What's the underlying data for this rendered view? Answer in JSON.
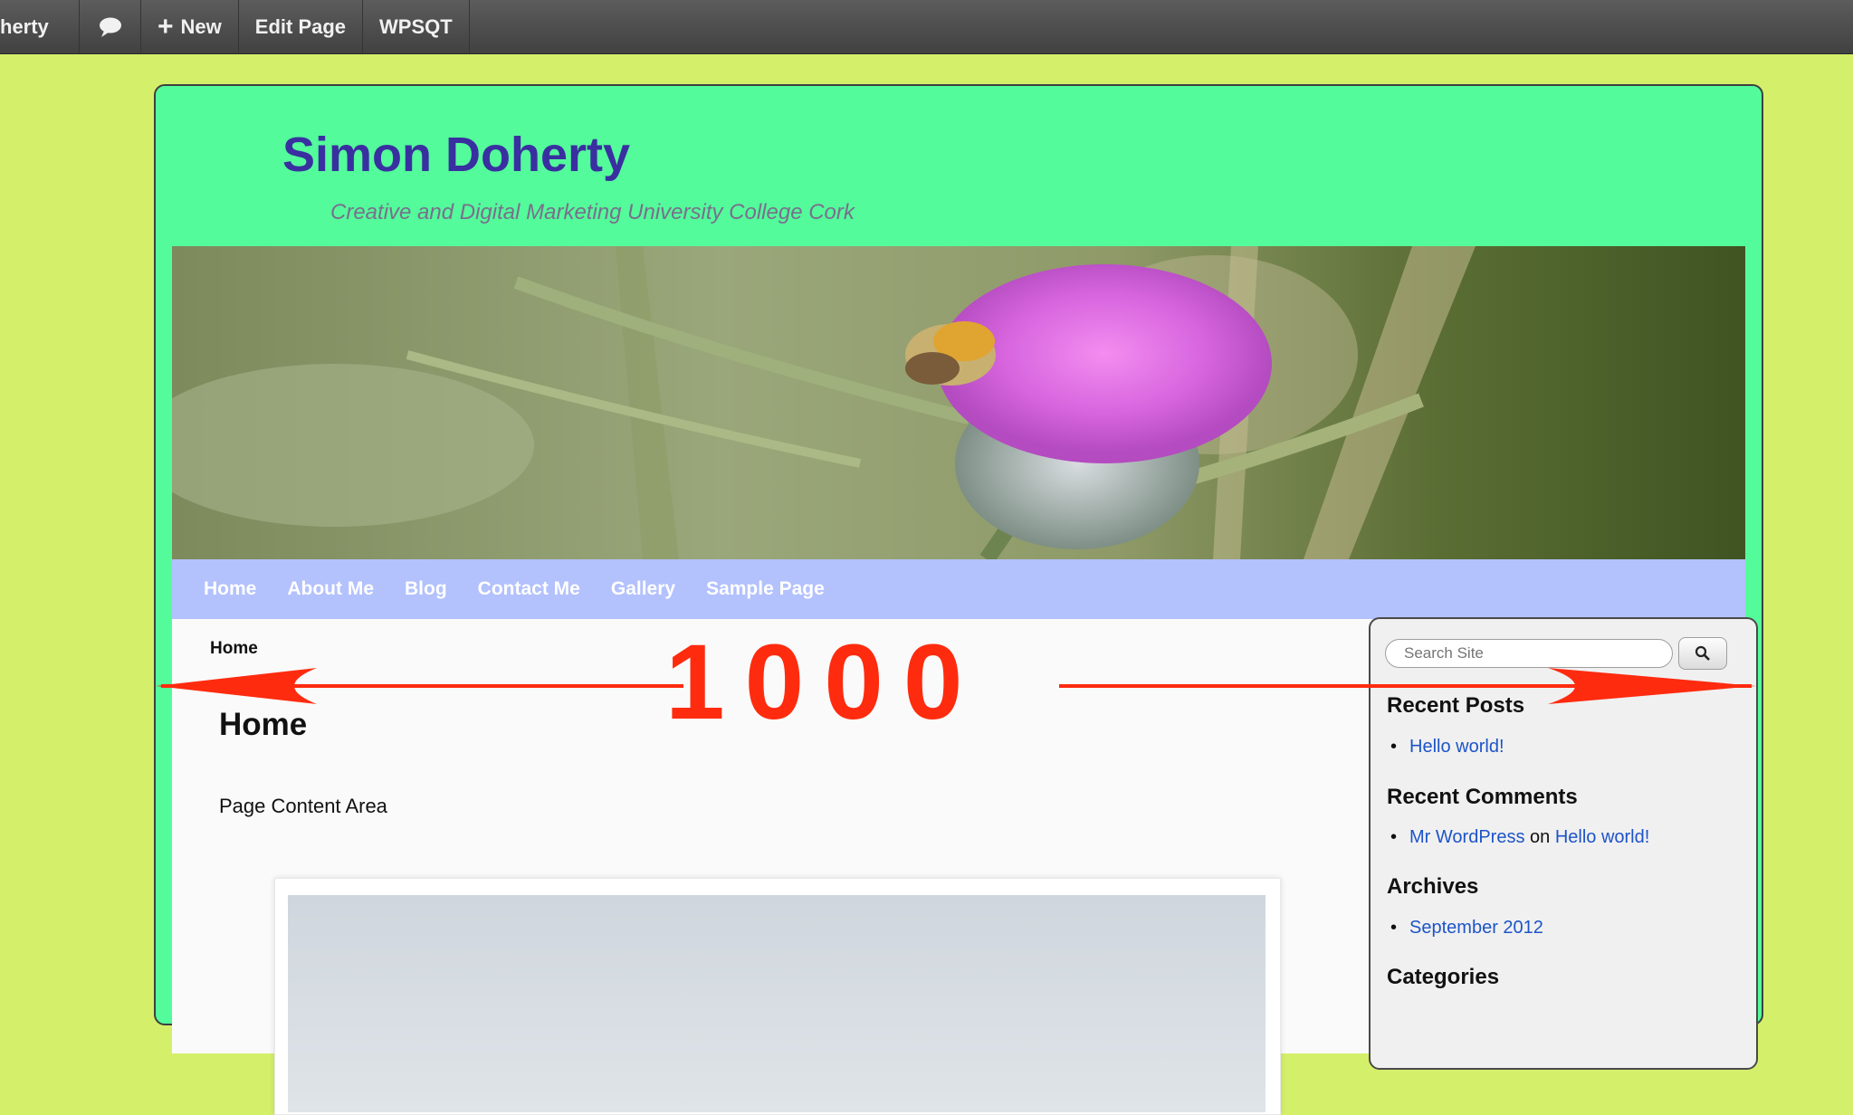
{
  "admin_bar": {
    "user_label": "herty",
    "new_label": "New",
    "edit_label": "Edit Page",
    "plugin_label": "WPSQT"
  },
  "site": {
    "title": "Simon Doherty",
    "description": "Creative and Digital Marketing University College Cork"
  },
  "nav": {
    "items": [
      "Home",
      "About Me",
      "Blog",
      "Contact Me",
      "Gallery",
      "Sample Page"
    ]
  },
  "content": {
    "breadcrumb": "Home",
    "page_title": "Home",
    "page_text": "Page Content Area"
  },
  "sidebar": {
    "search_placeholder": "Search Site",
    "recent_posts_title": "Recent Posts",
    "recent_posts": [
      "Hello world!"
    ],
    "recent_comments_title": "Recent Comments",
    "comment_author": "Mr WordPress",
    "comment_on": "on",
    "comment_post": "Hello world!",
    "archives_title": "Archives",
    "archives": [
      "September 2012"
    ],
    "categories_title": "Categories"
  },
  "overlay": {
    "measure_label": "1000",
    "color": "#ff2b0f"
  },
  "colors": {
    "page_bg": "#d4f06a",
    "wrapper_bg": "#53fb9b",
    "title_color": "#3a2fa0",
    "nav_bg": "#b3c1fd",
    "link_color": "#1d54c7"
  }
}
